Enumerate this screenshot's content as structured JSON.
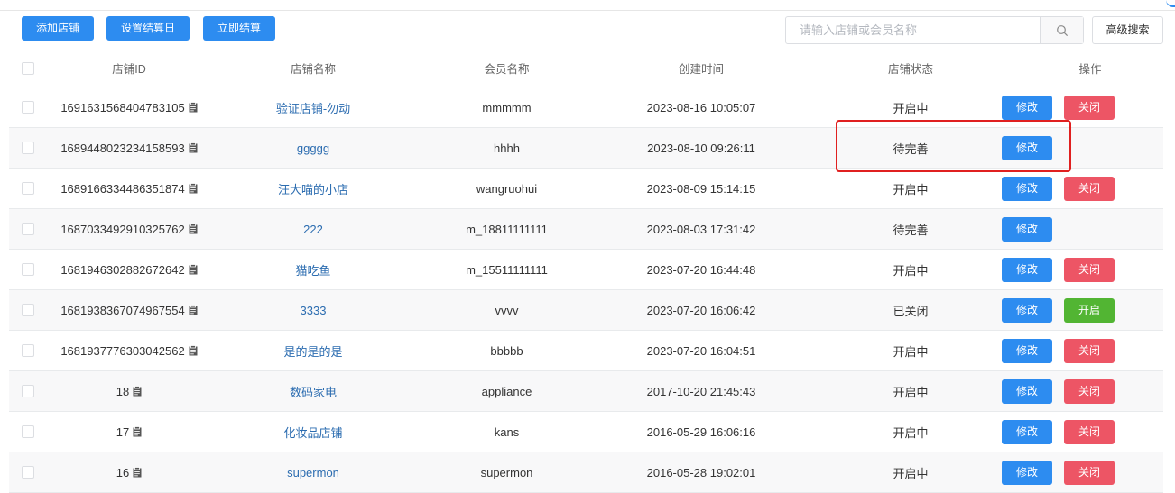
{
  "toolbar": {
    "add_label": "添加店铺",
    "settle_day_label": "设置结算日",
    "settle_now_label": "立即结算",
    "search_placeholder": "请输入店铺或会员名称",
    "advanced_label": "高级搜索"
  },
  "table": {
    "headers": {
      "id": "店铺ID",
      "name": "店铺名称",
      "member": "会员名称",
      "created": "创建时间",
      "status": "店铺状态",
      "ops": "操作"
    },
    "rows": [
      {
        "id": "1691631568404783105",
        "name": "验证店铺-勿动",
        "member": "mmmmm",
        "created": "2023-08-16 10:05:07",
        "status": "开启中",
        "edit": "修改",
        "toggle": "关闭"
      },
      {
        "id": "1689448023234158593",
        "name": "ggggg",
        "member": "hhhh",
        "created": "2023-08-10 09:26:11",
        "status": "待完善",
        "edit": "修改",
        "toggle": ""
      },
      {
        "id": "1689166334486351874",
        "name": "汪大喵的小店",
        "member": "wangruohui",
        "created": "2023-08-09 15:14:15",
        "status": "开启中",
        "edit": "修改",
        "toggle": "关闭"
      },
      {
        "id": "1687033492910325762",
        "name": "222",
        "member": "m_18811111111",
        "created": "2023-08-03 17:31:42",
        "status": "待完善",
        "edit": "修改",
        "toggle": ""
      },
      {
        "id": "1681946302882672642",
        "name": "猫吃鱼",
        "member": "m_15511111111",
        "created": "2023-07-20 16:44:48",
        "status": "开启中",
        "edit": "修改",
        "toggle": "关闭"
      },
      {
        "id": "1681938367074967554",
        "name": "3333",
        "member": "vvvv",
        "created": "2023-07-20 16:06:42",
        "status": "已关闭",
        "edit": "修改",
        "toggle": "开启"
      },
      {
        "id": "1681937776303042562",
        "name": "是的是的是",
        "member": "bbbbb",
        "created": "2023-07-20 16:04:51",
        "status": "开启中",
        "edit": "修改",
        "toggle": "关闭"
      },
      {
        "id": "18",
        "name": "数码家电",
        "member": "appliance",
        "created": "2017-10-20 21:45:43",
        "status": "开启中",
        "edit": "修改",
        "toggle": "关闭"
      },
      {
        "id": "17",
        "name": "化妆品店铺",
        "member": "kans",
        "created": "2016-05-29 16:06:16",
        "status": "开启中",
        "edit": "修改",
        "toggle": "关闭"
      },
      {
        "id": "16",
        "name": "supermon",
        "member": "supermon",
        "created": "2016-05-28 19:02:01",
        "status": "开启中",
        "edit": "修改",
        "toggle": "关闭"
      }
    ]
  },
  "icons": {
    "clipboard": "clipboard-icon",
    "search": "search-icon"
  },
  "colors": {
    "primary": "#2d8cf0",
    "danger": "#ed5565",
    "success": "#52b533",
    "highlight": "#e02020",
    "link": "#2b6cb0"
  }
}
